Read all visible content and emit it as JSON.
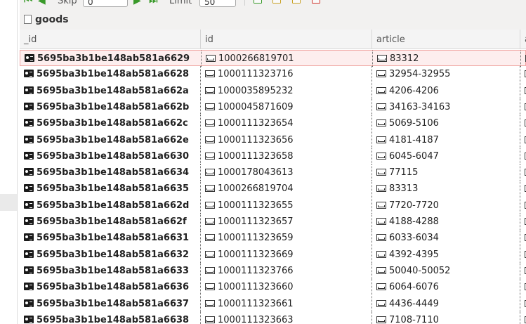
{
  "toolbar": {
    "skip_label": "Skip",
    "skip_value": "0",
    "limit_label": "Limit",
    "limit_value": "50"
  },
  "collection": {
    "name": "goods"
  },
  "columns": [
    "_id",
    "id",
    "article",
    "a"
  ],
  "rows": [
    {
      "oid": "5695ba3b1be148ab581a6629",
      "id": "1000266819701",
      "article": "83312"
    },
    {
      "oid": "5695ba3b1be148ab581a6628",
      "id": "1000111323716",
      "article": "32954-32955"
    },
    {
      "oid": "5695ba3b1be148ab581a662a",
      "id": "1000035895232",
      "article": "4206-4206"
    },
    {
      "oid": "5695ba3b1be148ab581a662b",
      "id": "1000045871609",
      "article": "34163-34163"
    },
    {
      "oid": "5695ba3b1be148ab581a662c",
      "id": "1000111323654",
      "article": "5069-5106"
    },
    {
      "oid": "5695ba3b1be148ab581a662e",
      "id": "1000111323656",
      "article": "4181-4187"
    },
    {
      "oid": "5695ba3b1be148ab581a6630",
      "id": "1000111323658",
      "article": "6045-6047"
    },
    {
      "oid": "5695ba3b1be148ab581a6634",
      "id": "1000178043613",
      "article": "77115"
    },
    {
      "oid": "5695ba3b1be148ab581a6635",
      "id": "1000266819704",
      "article": "83313"
    },
    {
      "oid": "5695ba3b1be148ab581a662d",
      "id": "1000111323655",
      "article": "7720-7720"
    },
    {
      "oid": "5695ba3b1be148ab581a662f",
      "id": "1000111323657",
      "article": "4188-4288"
    },
    {
      "oid": "5695ba3b1be148ab581a6631",
      "id": "1000111323659",
      "article": "6033-6034"
    },
    {
      "oid": "5695ba3b1be148ab581a6632",
      "id": "1000111323669",
      "article": "4392-4395"
    },
    {
      "oid": "5695ba3b1be148ab581a6633",
      "id": "1000111323766",
      "article": "50040-50052"
    },
    {
      "oid": "5695ba3b1be148ab581a6636",
      "id": "1000111323660",
      "article": "6064-6076"
    },
    {
      "oid": "5695ba3b1be148ab581a6637",
      "id": "1000111323661",
      "article": "4436-4449"
    },
    {
      "oid": "5695ba3b1be148ab581a6638",
      "id": "1000111323663",
      "article": "7108-7110"
    }
  ],
  "selected_row": 0,
  "icons": {
    "objectid": "id-card-icon",
    "string": "string-field-icon",
    "collection": "collection-icon"
  },
  "colors": {
    "selected_bg": "#fdeeee",
    "selected_border": "#f0a7a4",
    "nav_green": "#3a9a2a"
  }
}
